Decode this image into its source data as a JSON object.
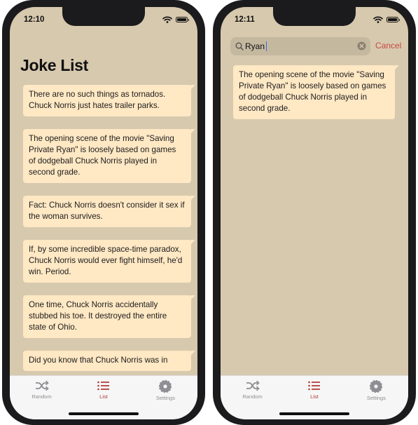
{
  "left_phone": {
    "status": {
      "time": "12:10"
    },
    "title": "Joke List",
    "jokes": [
      "There are no such things as tornados. Chuck Norris just hates trailer parks.",
      "The opening scene of the movie \"Saving Private Ryan\" is loosely based on games of dodgeball Chuck Norris played in second grade.",
      "Fact: Chuck Norris doesn't consider it sex if the woman survives.",
      "If, by some incredible space-time paradox, Chuck Norris would ever fight himself, he'd win. Period.",
      "One time, Chuck Norris accidentally stubbed his toe. It destroyed the entire state of Ohio.",
      "Did you know that Chuck Norris was in"
    ]
  },
  "right_phone": {
    "status": {
      "time": "12:11"
    },
    "search": {
      "value": "Ryan",
      "cancel_label": "Cancel"
    },
    "results": [
      "The opening scene of the movie \"Saving Private Ryan\" is loosely based on games of dodgeball Chuck Norris played in second grade."
    ]
  },
  "tabs": [
    {
      "label": "Random",
      "icon": "shuffle-icon"
    },
    {
      "label": "List",
      "icon": "list-icon",
      "selected": true
    },
    {
      "label": "Settings",
      "icon": "gear-icon"
    }
  ],
  "colors": {
    "background": "#d7c9ae",
    "bubble": "#ffe8c4",
    "accent": "#b33a3a",
    "tab_inactive": "#8e8e93"
  }
}
